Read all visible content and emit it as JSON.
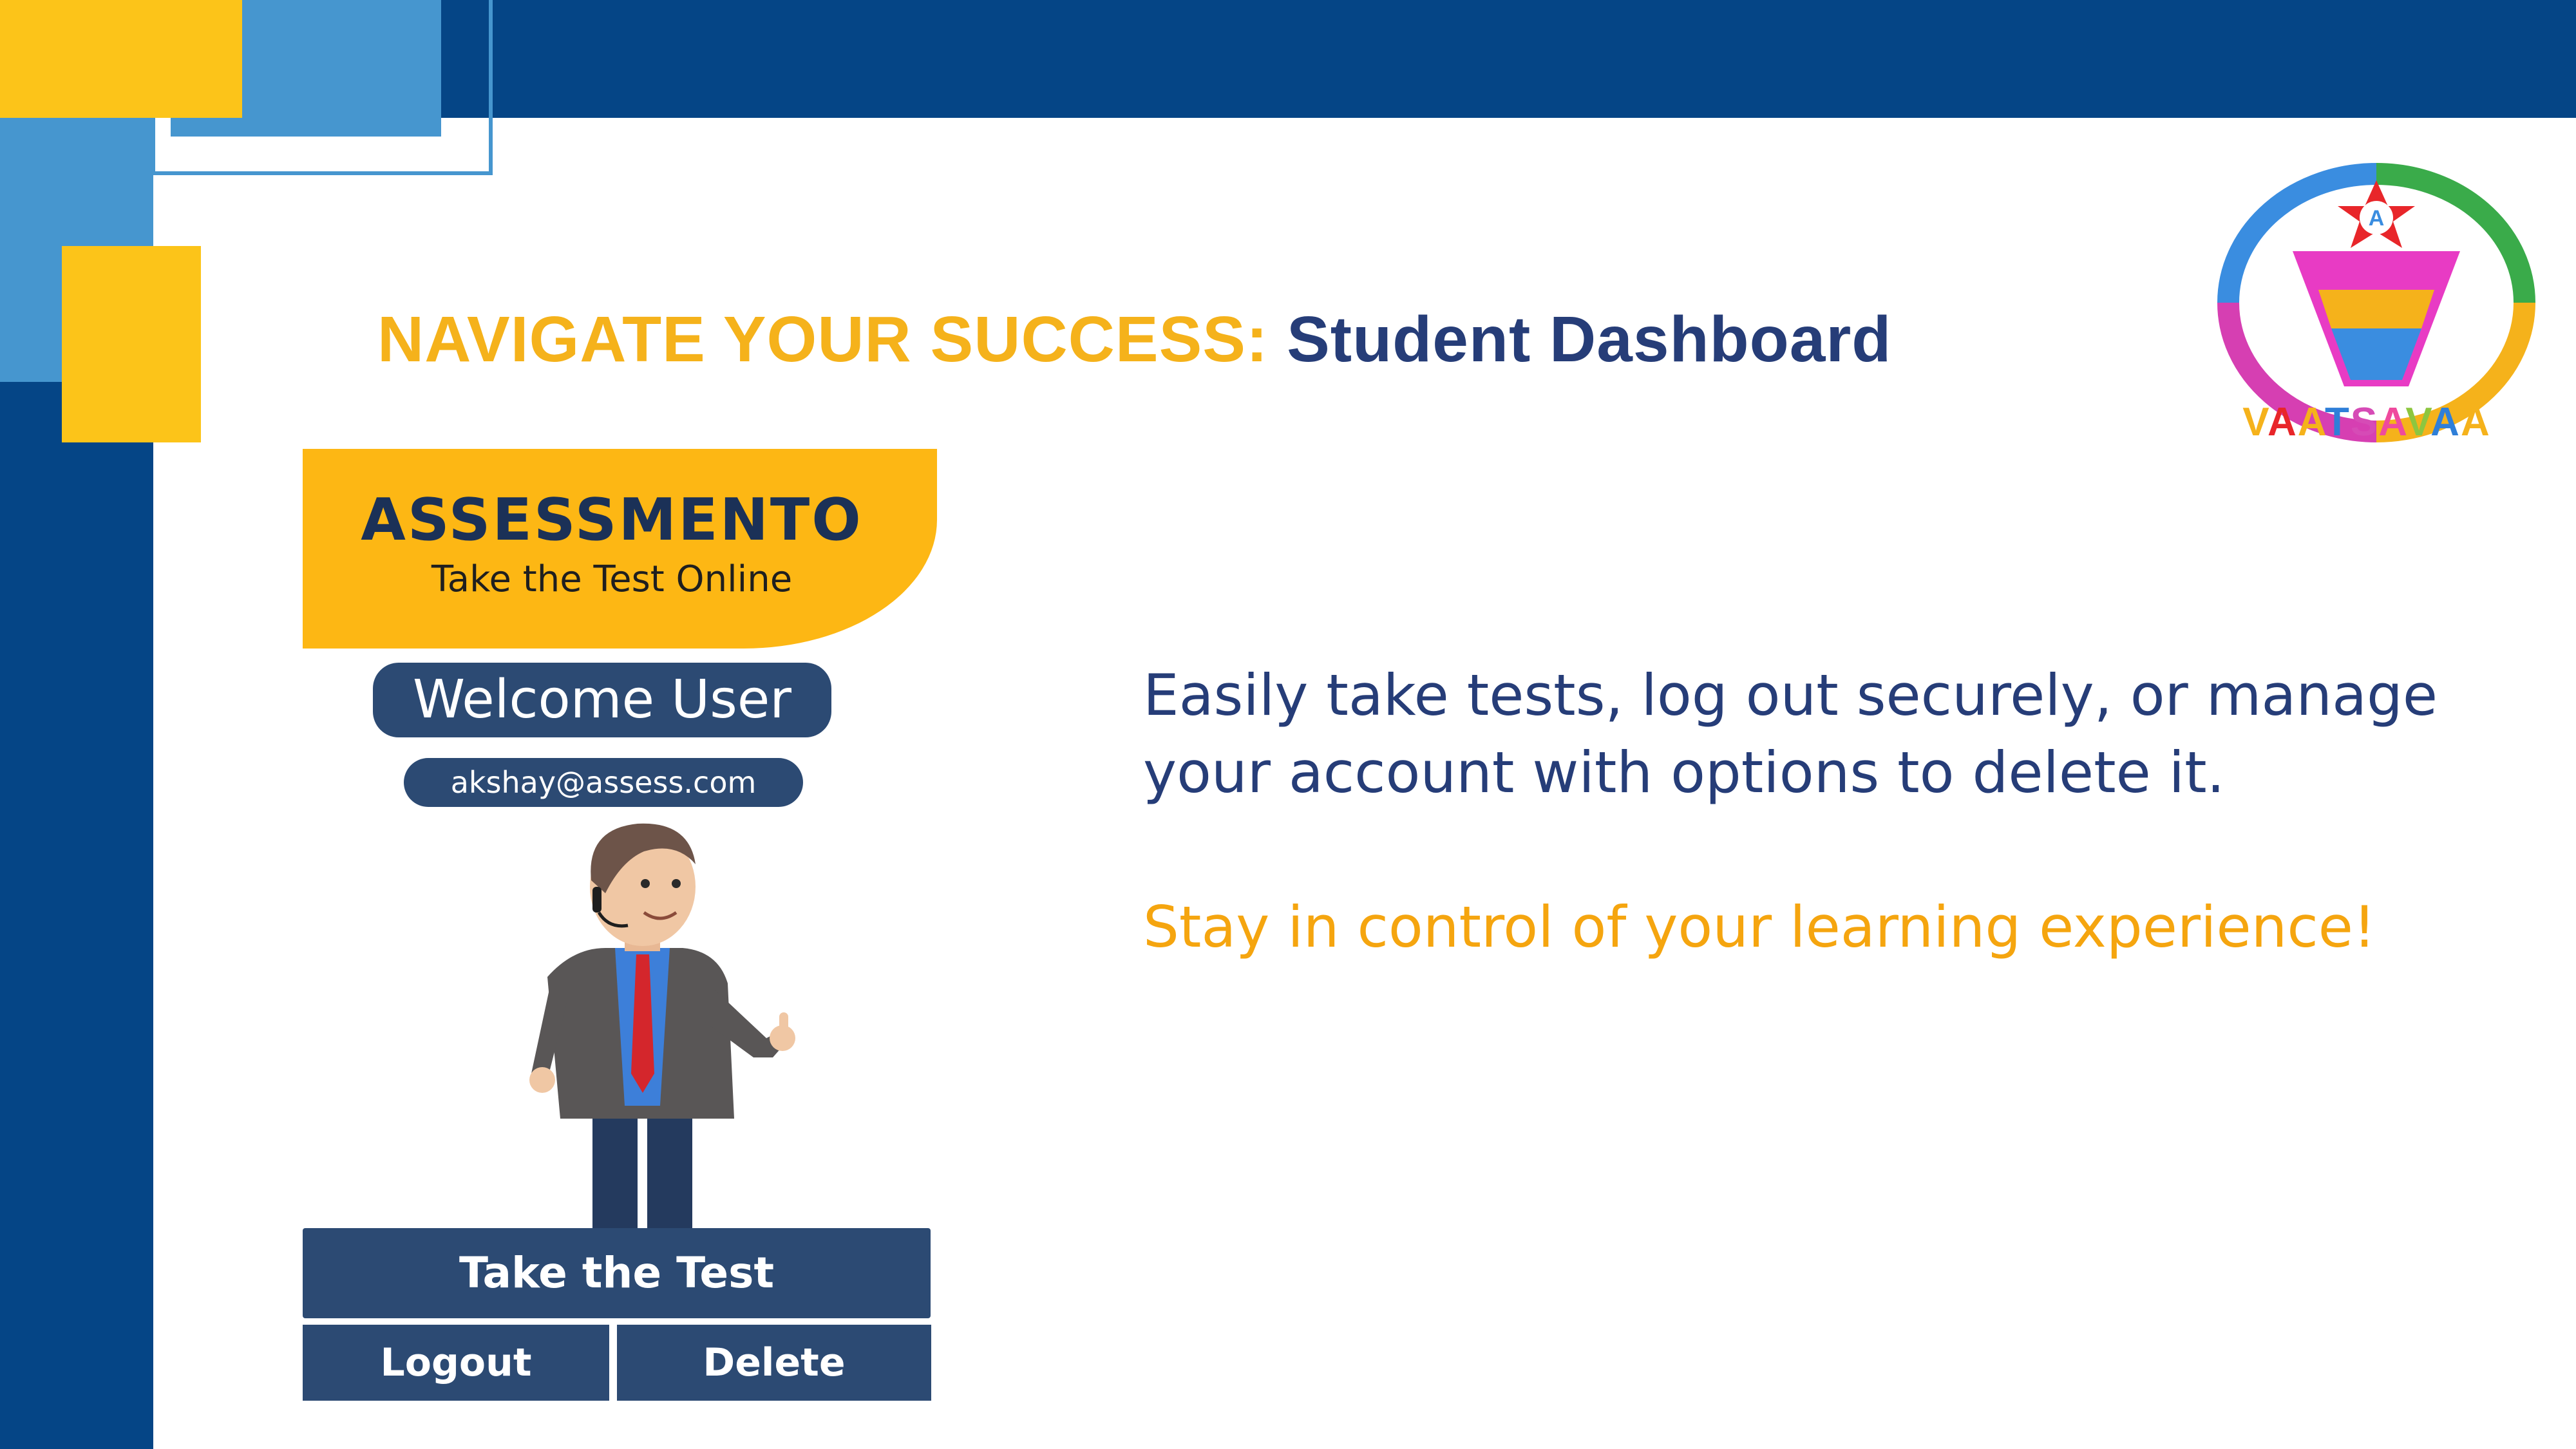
{
  "slide": {
    "heading_prefix": "NAVIGATE YOUR SUCCESS:",
    "heading_main": "Student Dashboard",
    "description": "Easily take tests, log out securely, or manage your account with options to delete it.",
    "tagline": "Stay in control of your learning experience!"
  },
  "logo": {
    "letters": [
      "V",
      "A",
      "A",
      "T",
      "S",
      "A",
      "V",
      "A",
      "A"
    ],
    "letter_colors": [
      "#f5b21b",
      "#e8262a",
      "#f5b21b",
      "#2f7fd8",
      "#d64bb6",
      "#ef4a9e",
      "#8dc63f",
      "#2f7fd8",
      "#f5b21b"
    ],
    "badge_letter": "A"
  },
  "app": {
    "brand_title": "ASSESSMENTO",
    "brand_subtitle": "Take the Test Online",
    "welcome_text": "Welcome User",
    "user_email": "akshay@assess.com",
    "avatar_icon": "cartoon-businessman-thumbs-up",
    "take_test_label": "Take the Test",
    "logout_label": "Logout",
    "delete_label": "Delete"
  },
  "colors": {
    "dark_blue": "#054586",
    "light_blue": "#4696cf",
    "yellow": "#fcc419",
    "app_button": "#2c4a73",
    "heading_orange": "#f5b21b",
    "heading_navy": "#263d78"
  }
}
